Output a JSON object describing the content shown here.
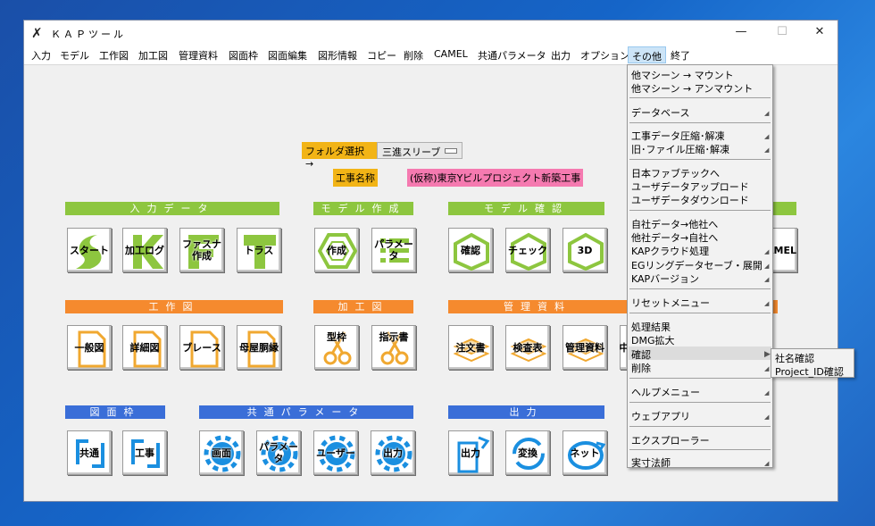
{
  "window": {
    "title": "ＫＡＰツール",
    "controls": {
      "minimize": "—",
      "maximize": "☐",
      "close": "✕"
    }
  },
  "menu": [
    "入力",
    "モデル",
    "工作図",
    "加工図",
    "管理資料",
    "図面枠",
    "図面編集",
    "図形情報",
    "コピー",
    "削除",
    "CAMEL",
    "共通パラメータ",
    "出力",
    "オプション",
    "その他",
    "終了"
  ],
  "folder": {
    "button": "フォルダ選択 →",
    "value": "三進スリーブ"
  },
  "project": {
    "label": "工事名称",
    "name": "(仮称)東京Yビルプロジェクト新築工事"
  },
  "sections": {
    "input_data": {
      "title": "入力データ",
      "buttons": [
        "スタート",
        "加工ログ",
        "ファスナ\n作成",
        "トラス"
      ]
    },
    "model_create": {
      "title": "モデル作成",
      "buttons": [
        "作成",
        "パラメータ"
      ]
    },
    "model_check": {
      "title": "モデル確認",
      "buttons": [
        "確認",
        "チェック",
        "3D",
        "AMEL"
      ]
    },
    "kousakuzu": {
      "title": "工作図",
      "buttons": [
        "一般図",
        "詳細図",
        "ブレース",
        "母屋胴縁"
      ]
    },
    "kakouzu": {
      "title": "加工図",
      "buttons": [
        "型枠",
        "指示書"
      ]
    },
    "kanri": {
      "title": "管理資料",
      "buttons": [
        "注文書",
        "検査表",
        "管理資料",
        "中"
      ]
    },
    "zumenwaku": {
      "title": "図面枠",
      "buttons": [
        "共通",
        "工事"
      ]
    },
    "common_params": {
      "title": "共通パラメータ",
      "buttons": [
        "画面",
        "パラメータ",
        "ユーザー",
        "出力"
      ]
    },
    "output": {
      "title": "出力",
      "buttons": [
        "出力",
        "変換",
        "ネット"
      ]
    }
  },
  "dropdown": {
    "items": [
      "他マシーン → マウント",
      "他マシーン → アンマウント",
      "データベース",
      "工事データ圧縮･解凍",
      "旧･ファイル圧縮･解凍",
      "日本ファブテックへ",
      "ユーザデータアップロード",
      "ユーザデータダウンロード",
      "自社データ→他社へ",
      "他社データ→自社へ",
      "KAPクラウド処理",
      "EGリングデータセーブ・展開",
      "KAPバージョン",
      "リセットメニュー",
      "処理結果",
      "DMG拡大",
      "確認",
      "削除",
      "ヘルプメニュー",
      "ウェブアプリ",
      "エクスプローラー",
      "実寸法師"
    ],
    "submenu_arrow": "◢"
  },
  "submenu": [
    "社名確認",
    "Project_ID確認"
  ],
  "colors": {
    "green": "#8dc63f",
    "orange": "#f58a2e",
    "blue": "#3a6ed8",
    "folder": "#f2b416",
    "project": "#f57ab0"
  }
}
